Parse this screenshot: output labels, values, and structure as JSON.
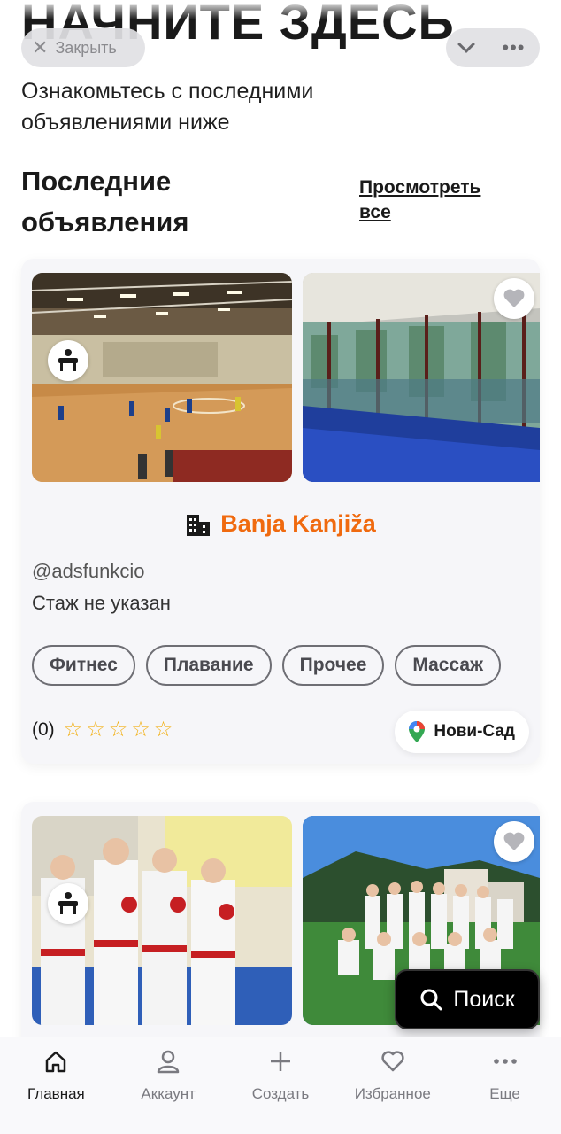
{
  "hero": {
    "title": "НАЧНИТЕ ЗДЕСЬ",
    "subtitle": "Ознакомьтесь с последними объявлениями ниже"
  },
  "browser": {
    "close_label": "Закрыть"
  },
  "section": {
    "title": "Последние объявления",
    "view_all": "Просмотреть все"
  },
  "listings": [
    {
      "venue_name": "Banja Kanjiža",
      "username": "@adsfunkcio",
      "experience": "Стаж не указан",
      "tags": [
        "Фитнес",
        "Плавание",
        "Прочее",
        "Массаж"
      ],
      "rating_count": "(0)",
      "stars": 5,
      "location": "Нови-Сад"
    },
    {}
  ],
  "search_button": {
    "label": "Поиск"
  },
  "nav": [
    {
      "label": "Главная",
      "icon": "home-icon",
      "active": true
    },
    {
      "label": "Аккаунт",
      "icon": "user-icon"
    },
    {
      "label": "Создать",
      "icon": "plus-icon"
    },
    {
      "label": "Избранное",
      "icon": "heart-icon"
    },
    {
      "label": "Еще",
      "icon": "more-icon"
    }
  ],
  "colors": {
    "accent": "#f06a0f",
    "star": "#f2b21b"
  }
}
